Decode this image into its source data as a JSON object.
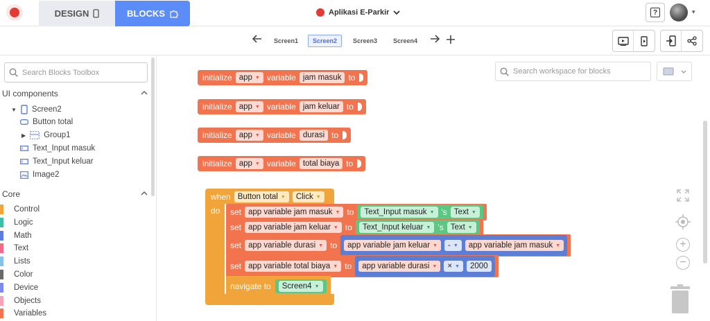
{
  "header": {
    "tab_design": "DESIGN",
    "tab_blocks": "BLOCKS",
    "project_name": "Aplikasi E-Parkir",
    "help_label": "?"
  },
  "screens": [
    "Screen1",
    "Screen2",
    "Screen3",
    "Screen4"
  ],
  "active_screen": "Screen2",
  "toolbox": {
    "search_placeholder": "Search Blocks Toolbox",
    "ui_section": "UI components",
    "tree": {
      "screen": "Screen2",
      "items": [
        "Button total",
        "Group1",
        "Text_Input masuk",
        "Text_Input keluar",
        "Image2"
      ]
    },
    "core_section": "Core",
    "core_items": [
      {
        "label": "Control",
        "color": "#f0a43a"
      },
      {
        "label": "Logic",
        "color": "#3dbfa7"
      },
      {
        "label": "Math",
        "color": "#5b7fd6"
      },
      {
        "label": "Text",
        "color": "#f06a8a"
      },
      {
        "label": "Lists",
        "color": "#84c3e8"
      },
      {
        "label": "Color",
        "color": "#6a6a6a"
      },
      {
        "label": "Device",
        "color": "#7d8af0"
      },
      {
        "label": "Objects",
        "color": "#f4a3b8"
      },
      {
        "label": "Variables",
        "color": "#f2744f"
      }
    ]
  },
  "workspace": {
    "search_placeholder": "Search workspace for blocks",
    "init_blocks": [
      {
        "kw": "initialize",
        "scope": "app",
        "var_kw": "variable",
        "name": "jam masuk",
        "to": "to"
      },
      {
        "kw": "initialize",
        "scope": "app",
        "var_kw": "variable",
        "name": "jam keluar",
        "to": "to"
      },
      {
        "kw": "initialize",
        "scope": "app",
        "var_kw": "variable",
        "name": "durasi",
        "to": "to"
      },
      {
        "kw": "initialize",
        "scope": "app",
        "var_kw": "variable",
        "name": "total biaya",
        "to": "to"
      }
    ],
    "event": {
      "when": "when",
      "component": "Button total",
      "event_name": "Click",
      "do": "do",
      "set_kw": "set",
      "to_kw": "to",
      "sets": [
        {
          "var": "app variable jam masuk",
          "comp": "Text_Input masuk",
          "prop_kw": "'s",
          "prop": "Text"
        },
        {
          "var": "app variable jam keluar",
          "comp": "Text_Input keluar",
          "prop_kw": "'s",
          "prop": "Text"
        },
        {
          "var": "app variable durasi",
          "left": "app variable jam keluar",
          "op": "-",
          "right": "app variable jam masuk"
        },
        {
          "var": "app variable total biaya",
          "left": "app variable durasi",
          "op": "×",
          "value": "2000"
        }
      ],
      "navigate_kw": "navigate to",
      "navigate_target": "Screen4"
    }
  }
}
